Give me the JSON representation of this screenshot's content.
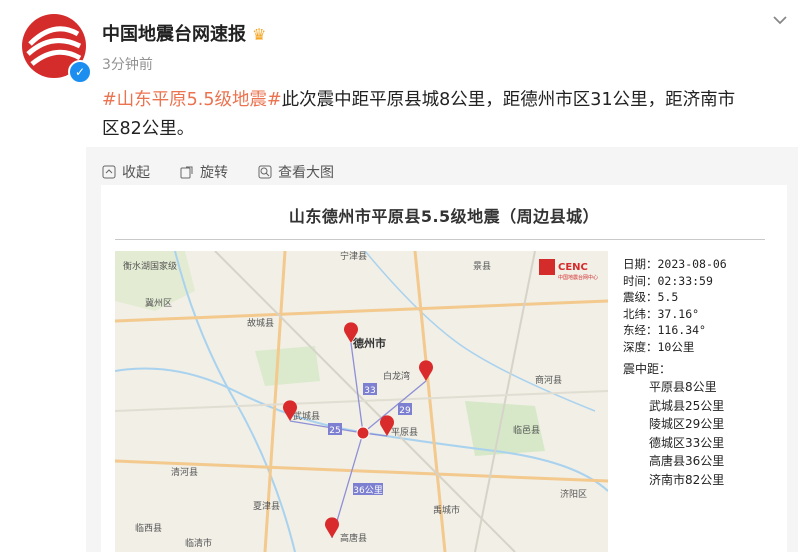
{
  "post": {
    "author": "中国地震台网速报",
    "time": "3分钟前",
    "hashtag": "#山东平原5.5级地震#",
    "body_line1": "此次震中距平原县城8公里，距德州市区31公里，距济南市",
    "body_line2": "区82公里。"
  },
  "actions": {
    "collapse": "收起",
    "rotate": "旋转",
    "view_large": "查看大图"
  },
  "card": {
    "title": "山东德州市平原县5.5级地震（周边县城）",
    "logo_text": "CENC",
    "logo_sub": "中国地震台网中心",
    "info": {
      "date": "日期：2023-08-06",
      "time": "时间：02:33:59",
      "magnitude": "震级：5.5",
      "lat": "北纬：37.16°",
      "lon": "东经：116.34°",
      "depth": "深度：10公里"
    },
    "distance_label": "震中距：",
    "distances": [
      "平原县8公里",
      "武城县25公里",
      "陵城区29公里",
      "德城区33公里",
      "高唐县36公里",
      "济南市82公里"
    ]
  },
  "map": {
    "labels": {
      "hengshui": "衡水湖国家级",
      "jizhou": "冀州区",
      "gucheng": "故城县",
      "jingxian": "景县",
      "ningjin": "宁津县",
      "dezhou": "德州市",
      "bailong": "白龙湾",
      "wucheng": "武城县",
      "pingyuan": "平原县",
      "xiajin": "夏津县",
      "qinghe": "清河县",
      "gaotang": "高唐县",
      "linyi": "临邑县",
      "shanghe": "商河县",
      "jiyang": "济阳区",
      "yucheng": "禹城市",
      "linxi": "临西县",
      "linqing": "临清市",
      "dist33": "33",
      "dist29": "29",
      "dist25": "25",
      "dist36": "36公里"
    }
  },
  "colors": {
    "tag": "#eb7350",
    "pin": "#d92b2b",
    "route": "#8e8fd6",
    "water": "#a9d2ef",
    "park": "#c6e3b5"
  }
}
